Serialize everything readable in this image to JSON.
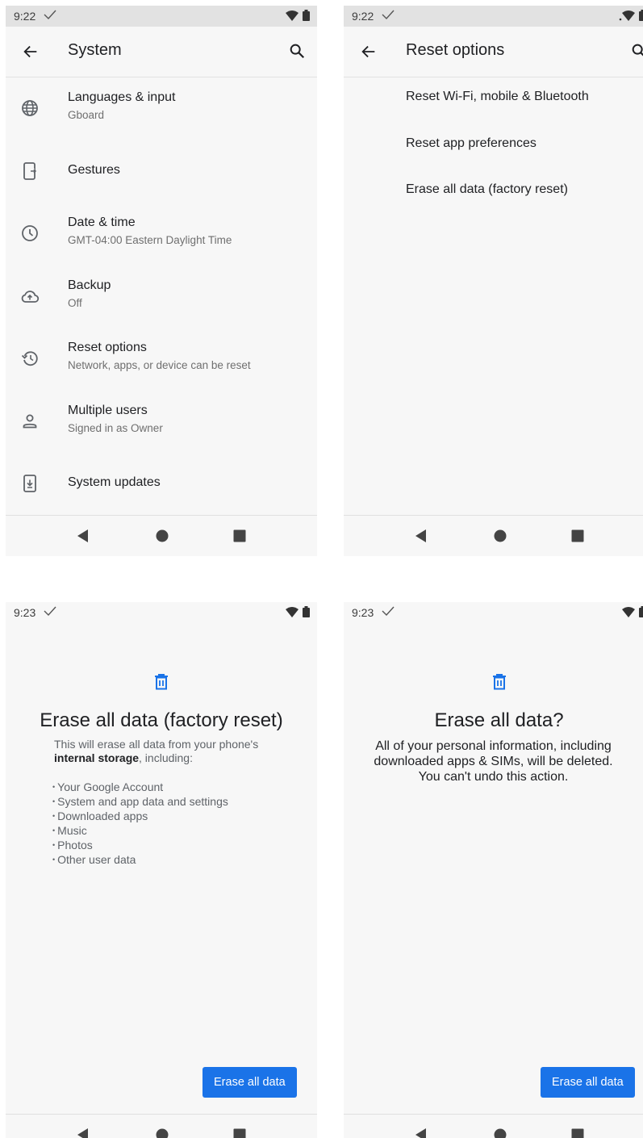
{
  "screen1": {
    "status": {
      "time": "9:22"
    },
    "appbar": {
      "title": "System"
    },
    "items": [
      {
        "title": "Languages & input",
        "subtitle": "Gboard"
      },
      {
        "title": "Gestures",
        "subtitle": ""
      },
      {
        "title": "Date & time",
        "subtitle": "GMT-04:00 Eastern Daylight Time"
      },
      {
        "title": "Backup",
        "subtitle": "Off"
      },
      {
        "title": "Reset options",
        "subtitle": "Network, apps, or device can be reset"
      },
      {
        "title": "Multiple users",
        "subtitle": "Signed in as Owner"
      },
      {
        "title": "System updates",
        "subtitle": ""
      }
    ]
  },
  "screen2": {
    "status": {
      "time": "9:22"
    },
    "appbar": {
      "title": "Reset options"
    },
    "options": [
      "Reset Wi-Fi, mobile & Bluetooth",
      "Reset app preferences",
      "Erase all data (factory reset)"
    ]
  },
  "screen3": {
    "status": {
      "time": "9:23"
    },
    "title": "Erase all data (factory reset)",
    "intro_before": "This will erase all data from your phone's",
    "intro_bold": "internal storage",
    "intro_after": ", including:",
    "bullets": [
      "Your Google Account",
      "System and app data and settings",
      "Downloaded apps",
      "Music",
      "Photos",
      "Other user data"
    ],
    "button": "Erase all data"
  },
  "screen4": {
    "status": {
      "time": "9:23"
    },
    "title": "Erase all data?",
    "description_lines": [
      "All of your personal information, including",
      "downloaded apps & SIMs, will be deleted.",
      "You can't undo this action."
    ],
    "button": "Erase all data"
  },
  "icons": [
    "check-icon",
    "wifi-icon",
    "battery-icon",
    "back-arrow-icon",
    "search-icon",
    "globe-icon",
    "gestures-icon",
    "clock-icon",
    "backup-cloud-icon",
    "reset-history-icon",
    "person-icon",
    "system-update-icon",
    "trash-icon",
    "nav-back-icon",
    "nav-home-icon",
    "nav-recents-icon"
  ],
  "colors": {
    "accent": "#1a73e8",
    "statusbar": "#e2e2e2",
    "background": "#f7f7f7",
    "icon": "#5f6368"
  }
}
